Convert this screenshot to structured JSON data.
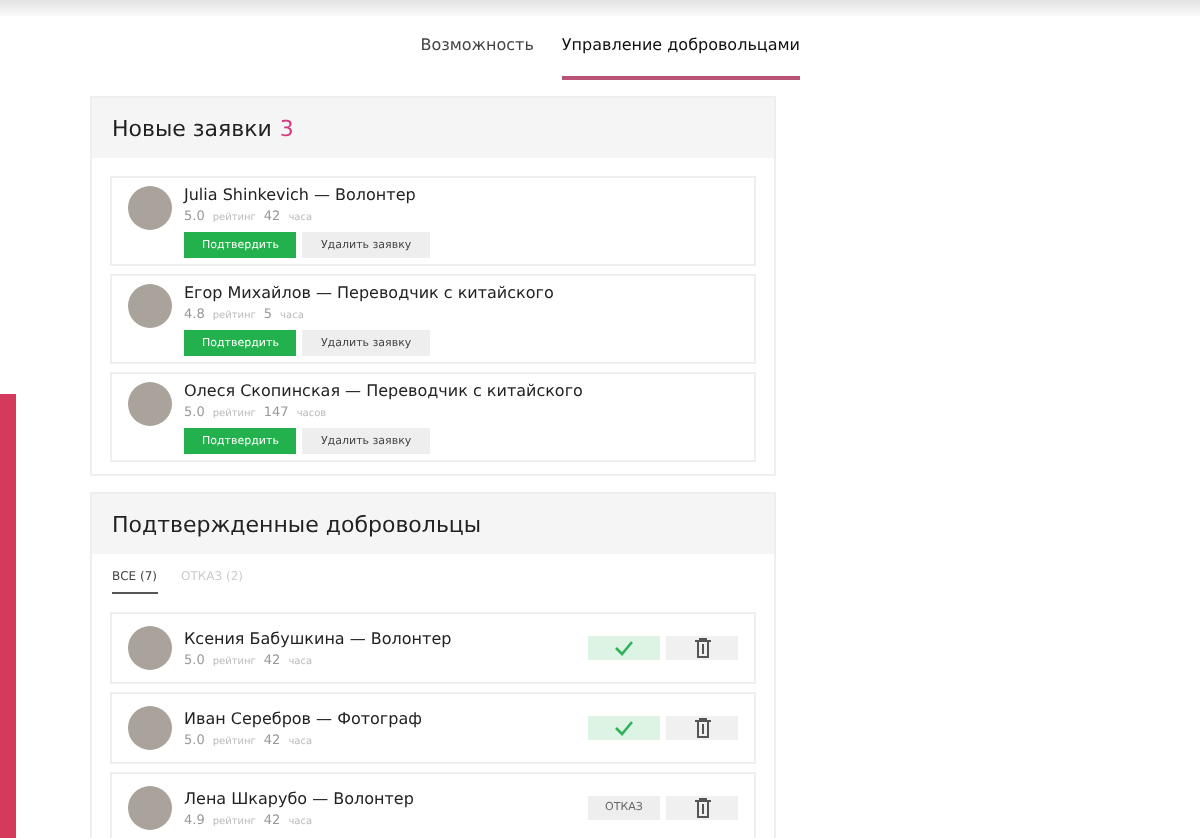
{
  "tabs": [
    {
      "label": "Возможность",
      "selected": false
    },
    {
      "label": "Управление добровольцами",
      "selected": true
    }
  ],
  "new_requests": {
    "title": "Новые заявки",
    "count": "3",
    "items": [
      {
        "name": "Julia Shinkevich — Волонтер",
        "rating": "5.0",
        "rating_label": "рейтинг",
        "hours": "42",
        "hours_label": "часа",
        "confirm_label": "Подтвердить",
        "delete_label": "Удалить заявку"
      },
      {
        "name": "Егор Михайлов — Переводчик с китайского",
        "rating": "4.8",
        "rating_label": "рейтинг",
        "hours": "5",
        "hours_label": "часа",
        "confirm_label": "Подтвердить",
        "delete_label": "Удалить заявку"
      },
      {
        "name": "Олеся Скопинская — Переводчик с китайского",
        "rating": "5.0",
        "rating_label": "рейтинг",
        "hours": "147",
        "hours_label": "часов",
        "confirm_label": "Подтвердить",
        "delete_label": "Удалить заявку"
      }
    ]
  },
  "confirmed": {
    "title": "Подтвержденные добровольцы",
    "filters": [
      {
        "label": "ВСЕ (7)",
        "selected": true
      },
      {
        "label": "ОТКАЗ (2)",
        "selected": false
      }
    ],
    "items": [
      {
        "kind": "confirmed",
        "name": "Ксения Бабушкина — Волонтер",
        "rating": "5.0",
        "rating_label": "рейтинг",
        "hours": "42",
        "hours_label": "часа"
      },
      {
        "kind": "confirmed",
        "name": "Иван Серебров — Фотограф",
        "rating": "5.0",
        "rating_label": "рейтинг",
        "hours": "42",
        "hours_label": "часа"
      },
      {
        "kind": "refused",
        "status": "ОТКАЗ",
        "name": "Лена Шкарубо — Волонтер",
        "rating": "4.9",
        "rating_label": "рейтинг",
        "hours": "42",
        "hours_label": "часа"
      }
    ]
  }
}
